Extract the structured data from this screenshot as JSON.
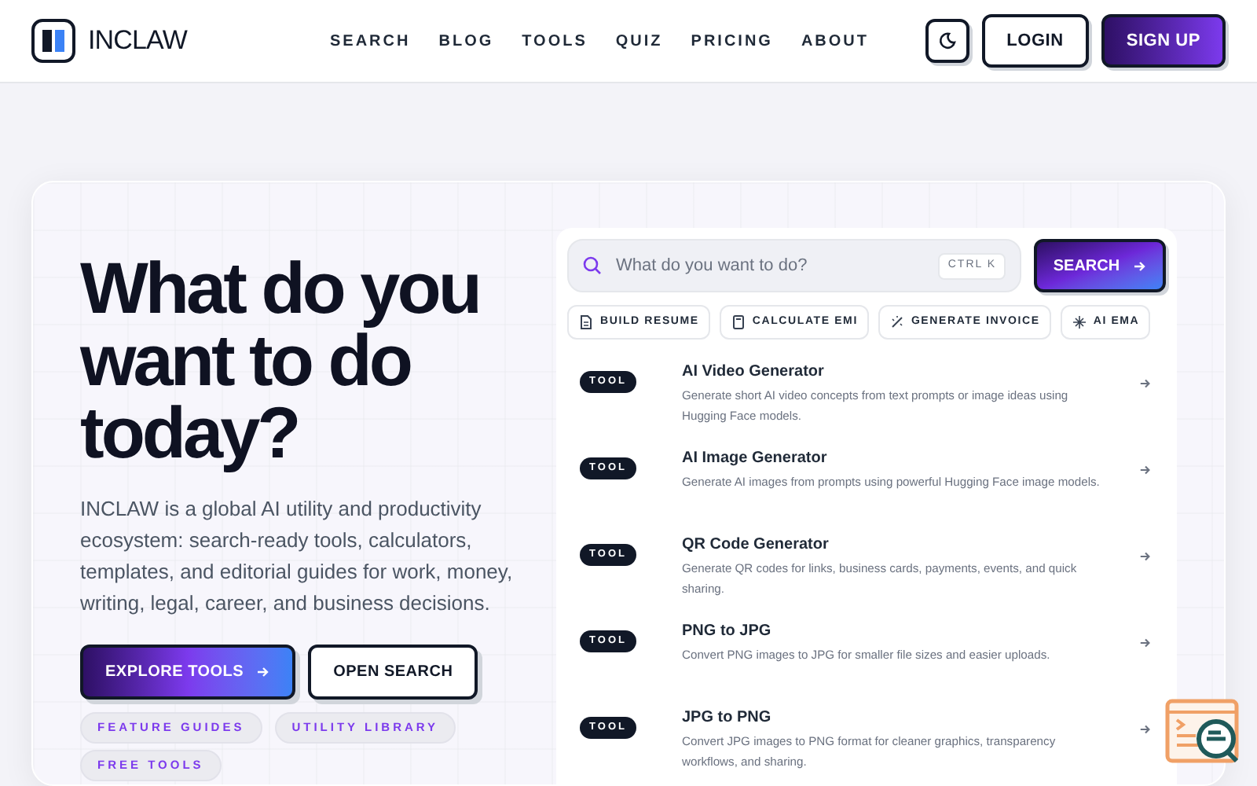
{
  "brand": {
    "name": "INCLAW"
  },
  "nav": [
    {
      "label": "SEARCH"
    },
    {
      "label": "BLOG"
    },
    {
      "label": "TOOLS"
    },
    {
      "label": "QUIZ"
    },
    {
      "label": "PRICING"
    },
    {
      "label": "ABOUT"
    }
  ],
  "header_actions": {
    "login": "LOGIN",
    "signup": "SIGN UP"
  },
  "hero": {
    "title": "What do you want to do today?",
    "description": "INCLAW is a global AI utility and productivity ecosystem: search-ready tools, calculators, templates, and editorial guides for work, money, writing, legal, career, and business decisions.",
    "primary": "EXPLORE TOOLS",
    "secondary": "OPEN SEARCH",
    "tags": [
      "FEATURE GUIDES",
      "UTILITY LIBRARY",
      "FREE TOOLS"
    ]
  },
  "search": {
    "placeholder": "What do you want to do?",
    "shortcut": "CTRL K",
    "button": "SEARCH"
  },
  "quick_actions": [
    {
      "kind": "document",
      "label": "BUILD RESUME"
    },
    {
      "kind": "calculator",
      "label": "CALCULATE EMI"
    },
    {
      "kind": "wand",
      "label": "GENERATE INVOICE"
    },
    {
      "kind": "sparkle",
      "label": "AI EMA"
    }
  ],
  "results": [
    {
      "badge": "TOOL",
      "title": "AI Video Generator",
      "description": "Generate short AI video concepts from text prompts or image ideas using Hugging Face models."
    },
    {
      "badge": "TOOL",
      "title": "AI Image Generator",
      "description": "Generate AI images from prompts using powerful Hugging Face image models."
    },
    {
      "badge": "TOOL",
      "title": "QR Code Generator",
      "description": "Generate QR codes for links, business cards, payments, events, and quick sharing."
    },
    {
      "badge": "TOOL",
      "title": "PNG to JPG",
      "description": "Convert PNG images to JPG for smaller file sizes and easier uploads."
    },
    {
      "badge": "TOOL",
      "title": "JPG to PNG",
      "description": "Convert JPG images to PNG format for cleaner graphics, transparency workflows, and sharing."
    }
  ]
}
